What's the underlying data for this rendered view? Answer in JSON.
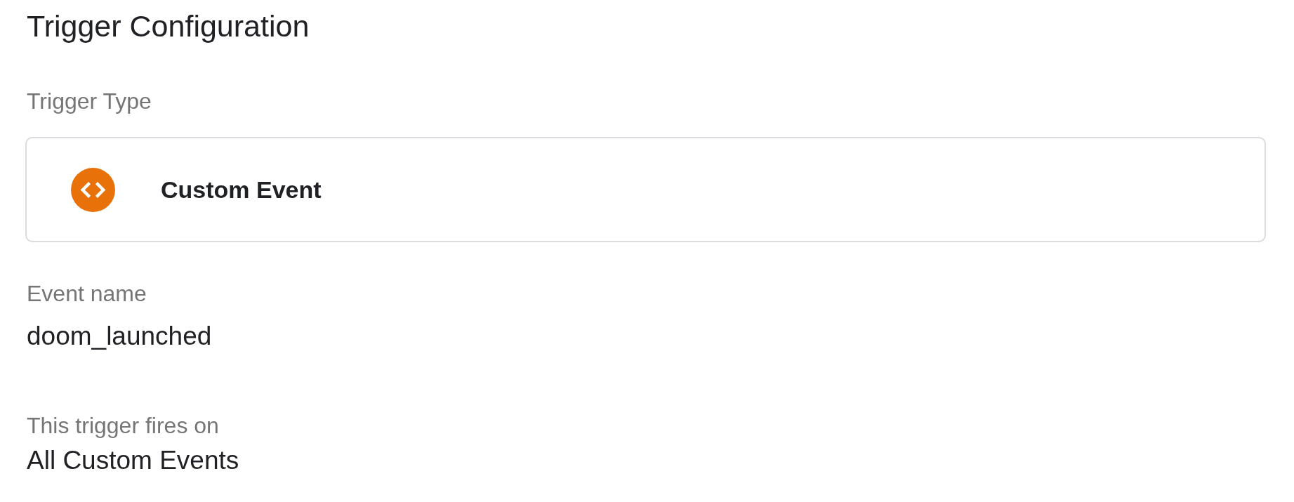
{
  "title": "Trigger Configuration",
  "trigger_type": {
    "label": "Trigger Type",
    "value": "Custom Event"
  },
  "fields": [
    {
      "label": "Event name",
      "value": "doom_launched"
    },
    {
      "label": "This trigger fires on",
      "value": "All Custom Events"
    }
  ]
}
